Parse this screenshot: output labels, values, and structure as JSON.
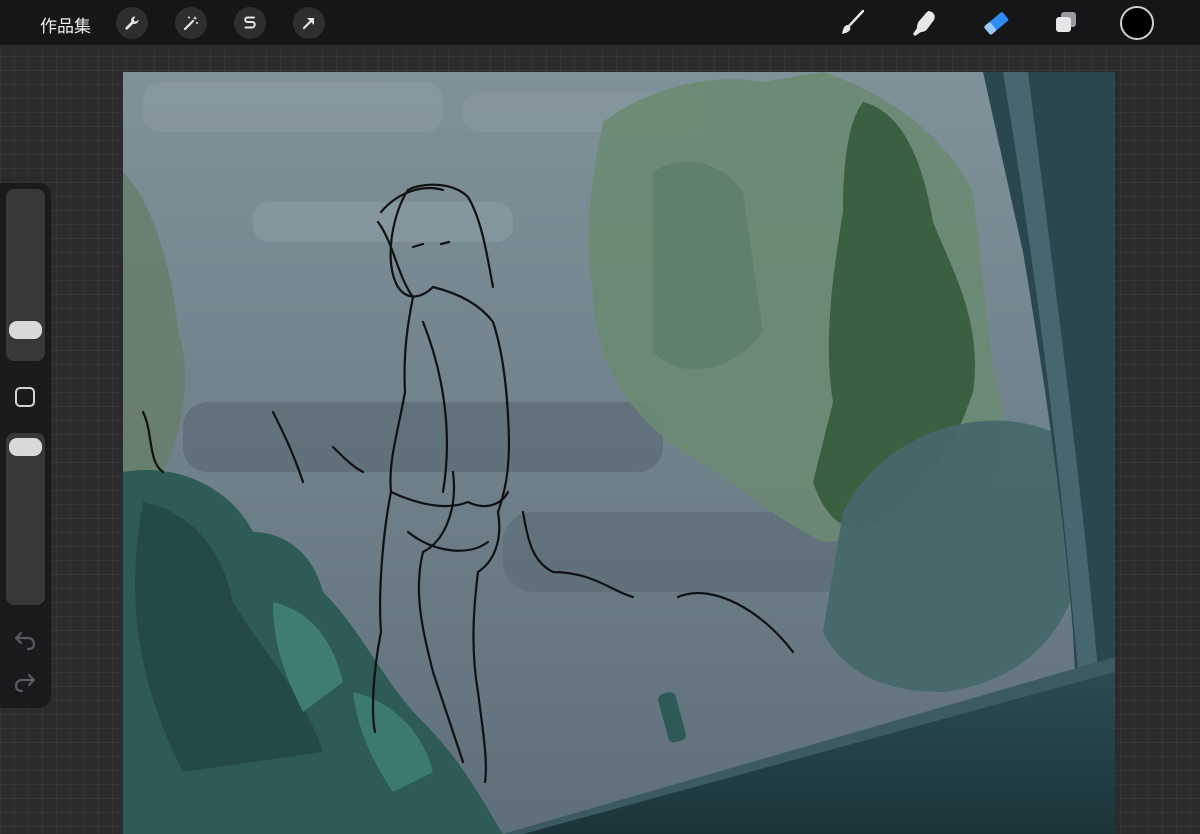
{
  "toolbar": {
    "gallery_label": "作品集",
    "left_tools": [
      {
        "name": "actions",
        "icon": "wrench-icon"
      },
      {
        "name": "adjustments",
        "icon": "magic-wand-icon"
      },
      {
        "name": "selection",
        "icon": "selection-s-icon"
      },
      {
        "name": "transform",
        "icon": "arrow-cursor-icon"
      }
    ],
    "right_tools": [
      {
        "name": "brush",
        "icon": "brush-icon",
        "active": false
      },
      {
        "name": "smudge",
        "icon": "smudge-finger-icon",
        "active": false
      },
      {
        "name": "eraser",
        "icon": "eraser-icon",
        "active": true
      },
      {
        "name": "layers",
        "icon": "layers-icon",
        "active": false
      }
    ],
    "current_color": "#000000",
    "active_tool_color": "#2f8cf0"
  },
  "sidebar": {
    "brush_size_level": 0.18,
    "opacity_level": 0.92,
    "modify_button_icon": "square-outline-icon",
    "undo_icon": "undo-arrow-icon",
    "redo_icon": "redo-arrow-icon"
  },
  "canvas": {
    "content": "painting-in-progress",
    "palette": {
      "sky": "#7a8d95",
      "fog": "#6e7f89",
      "tree_light": "#6f8d74",
      "tree_dark": "#3a5e40",
      "bush": "#2e5e58",
      "floor": "#1f3e44",
      "line_art": "#111111"
    }
  }
}
